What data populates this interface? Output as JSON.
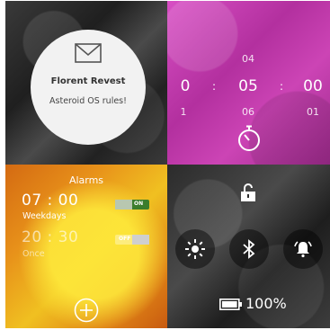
{
  "notification": {
    "icon": "mail-icon",
    "sender": "Florent Revest",
    "message": "Asteroid OS rules!"
  },
  "timer": {
    "above": [
      "04"
    ],
    "current": [
      "0",
      "05",
      "00"
    ],
    "below": [
      "1",
      "06",
      "01"
    ],
    "separator": ":",
    "icon": "stopwatch-icon"
  },
  "alarms": {
    "title": "Alarms",
    "items": [
      {
        "time": "07 : 00",
        "days": "Weekdays",
        "toggle": "ON",
        "enabled": true
      },
      {
        "time": "20 : 30",
        "days": "Once",
        "toggle": "OFF",
        "enabled": false
      }
    ],
    "add_icon": "plus-circle-icon"
  },
  "quick_settings": {
    "lock_icon": "unlock-icon",
    "buttons": [
      "brightness-icon",
      "bluetooth-icon",
      "ringer-icon"
    ],
    "battery": "100%"
  }
}
